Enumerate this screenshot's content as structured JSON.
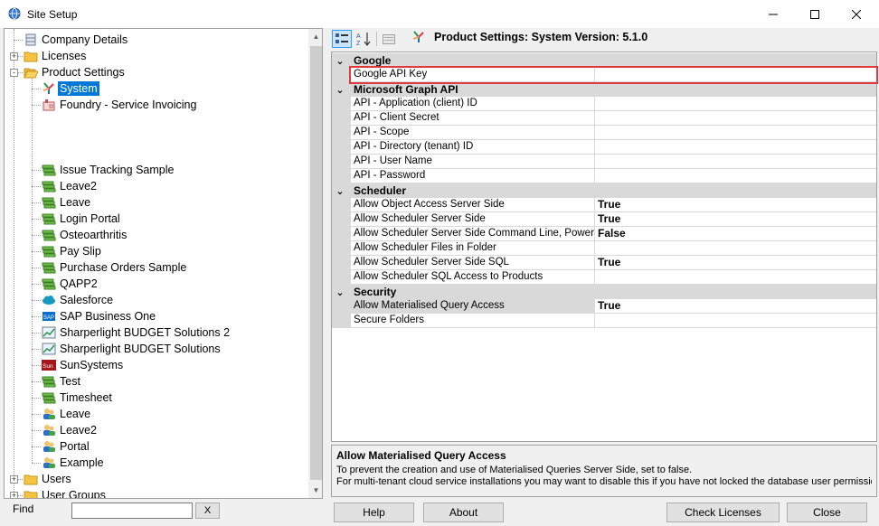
{
  "window": {
    "title": "Site Setup"
  },
  "tree": {
    "items": [
      {
        "label": "Company Details",
        "icon": "database-icon",
        "level": 1,
        "expander": ""
      },
      {
        "label": "Licenses",
        "icon": "folder-icon",
        "level": 1,
        "expander": "+"
      },
      {
        "label": "Product Settings",
        "icon": "folder-open-icon",
        "level": 1,
        "expander": "-"
      },
      {
        "label": "System",
        "icon": "sharperlight-logo-icon",
        "level": 2,
        "expander": "",
        "selected": true
      },
      {
        "label": "Foundry - Service Invoicing",
        "icon": "foundry-icon",
        "level": 2,
        "expander": ""
      },
      {
        "label": "Issue Tracking Sample",
        "icon": "green-stack-icon",
        "level": 2,
        "expander": ""
      },
      {
        "label": "Leave2",
        "icon": "green-stack-icon",
        "level": 2,
        "expander": ""
      },
      {
        "label": "Leave",
        "icon": "green-stack-icon",
        "level": 2,
        "expander": ""
      },
      {
        "label": "Login Portal",
        "icon": "green-stack-icon",
        "level": 2,
        "expander": ""
      },
      {
        "label": "Osteoarthritis",
        "icon": "green-stack-icon",
        "level": 2,
        "expander": ""
      },
      {
        "label": "Pay Slip",
        "icon": "green-stack-icon",
        "level": 2,
        "expander": ""
      },
      {
        "label": "Purchase Orders Sample",
        "icon": "green-stack-icon",
        "level": 2,
        "expander": ""
      },
      {
        "label": "QAPP2",
        "icon": "green-stack-icon",
        "level": 2,
        "expander": ""
      },
      {
        "label": "Salesforce",
        "icon": "salesforce-cloud-icon",
        "level": 2,
        "expander": ""
      },
      {
        "label": "SAP Business One",
        "icon": "sap-icon",
        "level": 2,
        "expander": ""
      },
      {
        "label": "Sharperlight BUDGET Solutions 2",
        "icon": "budget-chart-icon",
        "level": 2,
        "expander": ""
      },
      {
        "label": "Sharperlight BUDGET Solutions",
        "icon": "budget-chart-icon",
        "level": 2,
        "expander": ""
      },
      {
        "label": "SunSystems",
        "icon": "sunsystems-icon",
        "level": 2,
        "expander": ""
      },
      {
        "label": "Test",
        "icon": "green-stack-icon",
        "level": 2,
        "expander": ""
      },
      {
        "label": "Timesheet",
        "icon": "green-stack-icon",
        "level": 2,
        "expander": ""
      },
      {
        "label": "Leave",
        "icon": "users-icon",
        "level": 2,
        "expander": ""
      },
      {
        "label": "Leave2",
        "icon": "users-icon",
        "level": 2,
        "expander": ""
      },
      {
        "label": "Portal",
        "icon": "users-icon",
        "level": 2,
        "expander": ""
      },
      {
        "label": "Example",
        "icon": "users-icon",
        "level": 2,
        "expander": ""
      },
      {
        "label": "Users",
        "icon": "folder-icon",
        "level": 1,
        "expander": "+"
      },
      {
        "label": "User Groups",
        "icon": "folder-icon",
        "level": 1,
        "expander": "+"
      }
    ]
  },
  "find": {
    "label": "Find",
    "value": "",
    "clear_label": "X"
  },
  "toolbar": {
    "title": "Product Settings: System Version: 5.1.0"
  },
  "grid": {
    "categories": [
      {
        "name": "Google",
        "props": [
          {
            "name": "Google API Key",
            "value": ""
          }
        ]
      },
      {
        "name": "Microsoft Graph API",
        "props": [
          {
            "name": "API - Application (client) ID",
            "value": ""
          },
          {
            "name": "API - Client Secret",
            "value": ""
          },
          {
            "name": "API - Scope",
            "value": ""
          },
          {
            "name": "API - Directory (tenant) ID",
            "value": ""
          },
          {
            "name": "API - User Name",
            "value": ""
          },
          {
            "name": "API - Password",
            "value": ""
          }
        ]
      },
      {
        "name": "Scheduler",
        "props": [
          {
            "name": "Allow Object Access Server Side",
            "value": "True"
          },
          {
            "name": "Allow Scheduler Server Side",
            "value": "True"
          },
          {
            "name": "Allow Scheduler Server Side Command Line, PowerShell",
            "value": "False"
          },
          {
            "name": "Allow Scheduler Files in Folder",
            "value": ""
          },
          {
            "name": "Allow Scheduler Server Side SQL",
            "value": "True"
          },
          {
            "name": "Allow Scheduler SQL Access to Products",
            "value": ""
          }
        ]
      },
      {
        "name": "Security",
        "props": [
          {
            "name": "Allow Materialised Query Access",
            "value": "True",
            "selected": true
          },
          {
            "name": "Secure Folders",
            "value": ""
          }
        ]
      }
    ]
  },
  "description": {
    "title": "Allow Materialised Query Access",
    "line1": "To prevent the creation and use of Materialised Queries Server Side, set to false.",
    "line2": "For multi-tenant cloud service installations you may want to disable this if you have not locked the database user permission..."
  },
  "buttons": {
    "help": "Help",
    "about": "About",
    "check_licenses": "Check Licenses",
    "close": "Close"
  },
  "colors": {
    "selection": "#0078d7",
    "highlight_box": "#e0393e",
    "category_bg": "#d9d9d9"
  }
}
